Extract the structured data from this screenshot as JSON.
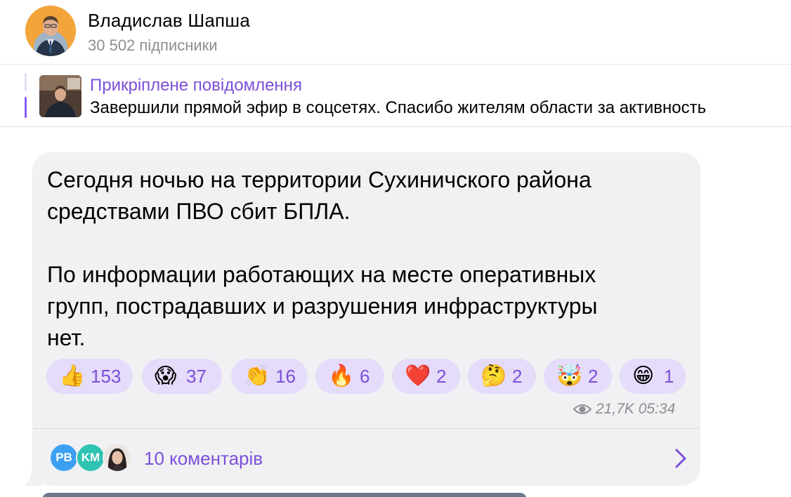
{
  "channel": {
    "name": "Владислав Шапша",
    "subscribers": "30 502 підписники"
  },
  "pinned": {
    "title": "Прикріплене повідомлення",
    "text": "Завершили прямой эфир в соцсетях. Спасибо жителям области за активность"
  },
  "message": {
    "paragraphs": [
      [
        "Сегодня ночью на территории Сухиничского района",
        "средствами ПВО  сбит БПЛА."
      ],
      [
        "По информации работающих на месте оперативных",
        "групп, пострадавших и разрушения инфраструктуры",
        "нет."
      ]
    ],
    "views": "21,7K",
    "time": "05:34"
  },
  "reactions": [
    {
      "emoji": "👍",
      "count": "153"
    },
    {
      "emoji": "😱",
      "count": "37"
    },
    {
      "emoji": "👏",
      "count": "16"
    },
    {
      "emoji": "🔥",
      "count": "6"
    },
    {
      "emoji": "❤️",
      "count": "2"
    },
    {
      "emoji": "🤔",
      "count": "2"
    },
    {
      "emoji": "🤯",
      "count": "2"
    },
    {
      "emoji": "😁",
      "count": "1"
    }
  ],
  "comments": {
    "label": "10 коментарів",
    "avatars": [
      {
        "initials": "PB",
        "color": "#3ba0f2"
      },
      {
        "initials": "KM",
        "color": "#2fc4b2"
      },
      {
        "initials": "",
        "color": "#d9d0c9"
      }
    ]
  },
  "colors": {
    "accent": "#7b4fd8",
    "reaction_bg": "#e5dbfa",
    "bubble_bg": "#f1f1f3"
  }
}
